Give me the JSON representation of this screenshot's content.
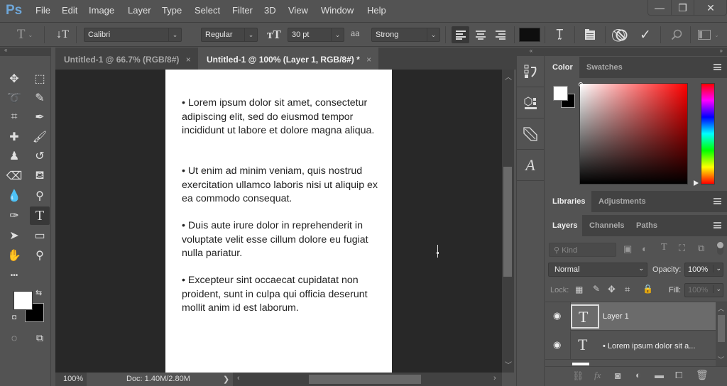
{
  "app": {
    "logo": "Ps"
  },
  "menu": [
    "File",
    "Edit",
    "Image",
    "Layer",
    "Type",
    "Select",
    "Filter",
    "3D",
    "View",
    "Window",
    "Help"
  ],
  "window_controls": {
    "minimize": "—",
    "restore": "❐",
    "close": "✕"
  },
  "options_bar": {
    "tool_icon": "type-tool",
    "font_family": "Calibri",
    "font_style": "Regular",
    "font_size": "30 pt",
    "antialias_label": "aa",
    "antialias": "Strong",
    "text_color": "#0e0e0e",
    "align_selected": "left"
  },
  "doc_tabs": [
    {
      "label": "Untitled-1 @ 66.7% (RGB/8#)",
      "active": false
    },
    {
      "label": "Untitled-1 @ 100% (Layer 1, RGB/8#) *",
      "active": true
    }
  ],
  "close_glyph": "×",
  "document": {
    "paragraphs": [
      "•  Lorem ipsum dolor sit amet, consectetur adipiscing elit, sed do eiusmod tempor incididunt ut labore et dolore magna aliqua.",
      "•  Ut enim ad minim veniam, quis nostrud exercitation ullamco laboris nisi ut aliquip ex ea commodo consequat.",
      "•  Duis aute irure dolor in reprehenderit in voluptate velit esse cillum dolore eu fugiat nulla pariatur.",
      "•  Excepteur sint occaecat cupidatat non proident, sunt in culpa qui officia deserunt mollit anim id est laborum."
    ]
  },
  "status": {
    "zoom": "100%",
    "doc": "Doc: 1.40M/2.80M",
    "arrow": "❯"
  },
  "tools": [
    [
      "move",
      "marquee"
    ],
    [
      "lasso",
      "quick-select"
    ],
    [
      "crop",
      "eyedropper"
    ],
    [
      "healing",
      "brush"
    ],
    [
      "clone-stamp",
      "history-brush"
    ],
    [
      "eraser",
      "paint-bucket"
    ],
    [
      "blur",
      "dodge"
    ],
    [
      "pen",
      "type"
    ],
    [
      "path-select",
      "rectangle"
    ],
    [
      "hand",
      "zoom"
    ]
  ],
  "tool_glyphs": {
    "move": "✥",
    "marquee": "⬚",
    "lasso": "➰",
    "quick-select": "✎",
    "crop": "⌗",
    "eyedropper": "✒",
    "healing": "✚",
    "brush": "🖌",
    "clone-stamp": "♟",
    "history-brush": "↺",
    "eraser": "⌫",
    "paint-bucket": "⛾",
    "blur": "💧",
    "dodge": "⚲",
    "pen": "✑",
    "type": "T",
    "path-select": "➤",
    "rectangle": "▭",
    "hand": "✋",
    "zoom": "⚲"
  },
  "extra_tools_glyph": "•••",
  "colors": {
    "foreground": "#ffffff",
    "background": "#000000"
  },
  "right": {
    "color_tabs": [
      "Color",
      "Swatches"
    ],
    "lib_tabs": [
      "Libraries",
      "Adjustments"
    ],
    "layer_tabs": [
      "Layers",
      "Channels",
      "Paths"
    ],
    "filter_kind": "Kind",
    "blend_mode": "Normal",
    "opacity_label": "Opacity:",
    "opacity": "100%",
    "lock_label": "Lock:",
    "fill_label": "Fill:",
    "fill": "100%",
    "layers": [
      {
        "name": "Layer 1",
        "selected": true,
        "visible": true
      },
      {
        "name": "• Lorem ipsum dolor sit a...",
        "selected": false,
        "visible": true
      }
    ]
  },
  "dock_glyphs": [
    "history",
    "3d",
    "properties",
    "character"
  ]
}
